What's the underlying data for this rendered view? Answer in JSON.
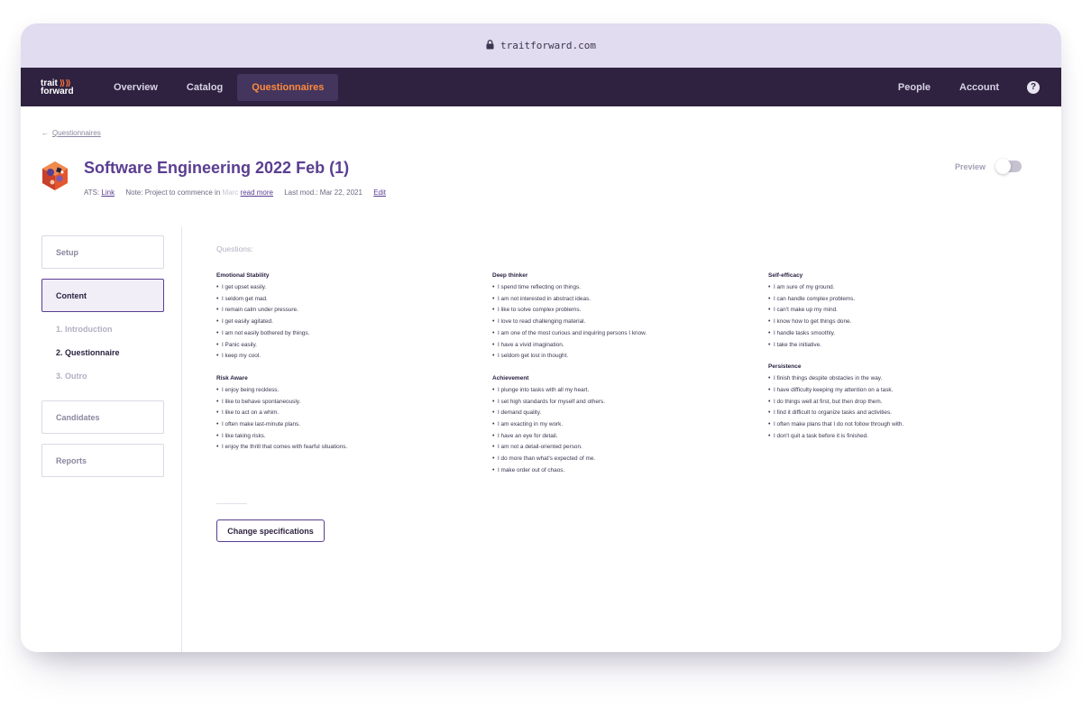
{
  "browser": {
    "url": "traitforward.com",
    "lock_icon": "lock-icon"
  },
  "nav": {
    "logo_line1": "trait",
    "logo_arrows": "⟫⟫",
    "logo_line2": "forward",
    "links": [
      "Overview",
      "Catalog",
      "Questionnaires"
    ],
    "active": "Questionnaires",
    "right_links": [
      "People",
      "Account"
    ],
    "help_label": "?"
  },
  "breadcrumb": {
    "arrow": "←",
    "label": "Questionnaires"
  },
  "project": {
    "title": "Software Engineering 2022 Feb (1)",
    "ats_label": "ATS:",
    "ats_link": "Link",
    "note_label": "Note: Project to commence in",
    "note_faded": "Marc",
    "read_more": "read more",
    "last_mod": "Last mod.: Mar 22, 2021",
    "edit": "Edit"
  },
  "preview": {
    "label": "Preview",
    "enabled": false
  },
  "sidebar": {
    "setup": "Setup",
    "content": "Content",
    "steps": [
      "1. Introduction",
      "2. Questionnaire",
      "3. Outro"
    ],
    "current_step": "2. Questionnaire",
    "candidates": "Candidates",
    "reports": "Reports"
  },
  "questions": {
    "heading": "Questions:",
    "columns": [
      [
        {
          "title": "Emotional Stability",
          "items": [
            "I get upset easily.",
            "I seldom get mad.",
            "I remain calm under pressure.",
            "I get easily agitated.",
            "I am not easily bothered by things.",
            "I Panic easily.",
            "I keep my cool."
          ]
        },
        {
          "title": "Risk Aware",
          "items": [
            "I enjoy being reckless.",
            "I like to behave spontaneously.",
            "I like to act on a whim.",
            "I often make last-minute plans.",
            "I like taking risks.",
            "I enjoy the thrill that comes with fearful situations."
          ]
        }
      ],
      [
        {
          "title": "Deep thinker",
          "items": [
            "I spend time reflecting on things.",
            "I am not interested in abstract ideas.",
            "I like to solve complex problems.",
            "I love to read challenging material.",
            "I am one of the most curious and inquiring persons I know.",
            "I have a vivid imagination.",
            "I seldom get lost in thought."
          ]
        },
        {
          "title": "Achievement",
          "items": [
            "I plunge into tasks with all my heart.",
            "I set high standards for myself and others.",
            "I demand quality.",
            "I am exacting in my work.",
            "I have an eye for detail.",
            "I am not a detail-oriented person.",
            "I do more than what's expected of me.",
            "I make order out of chaos."
          ]
        }
      ],
      [
        {
          "title": "Self-efficacy",
          "items": [
            "I am sure of my ground.",
            "I can handle complex problems.",
            "I can't make up my mind.",
            "I know how to get things done.",
            "I handle tasks smoothly.",
            "I take the initiative."
          ]
        },
        {
          "title": "Persistence",
          "items": [
            "I finish things despite obstacles in the way.",
            "I have difficulty keeping my attention on a task.",
            "I do things well at first, but then drop them.",
            "I find it difficult to organize tasks and activities.",
            "I often make plans that I do not follow through with.",
            "I don't quit a task before it is finished."
          ]
        }
      ]
    ]
  },
  "actions": {
    "change_specifications": "Change specifications"
  }
}
